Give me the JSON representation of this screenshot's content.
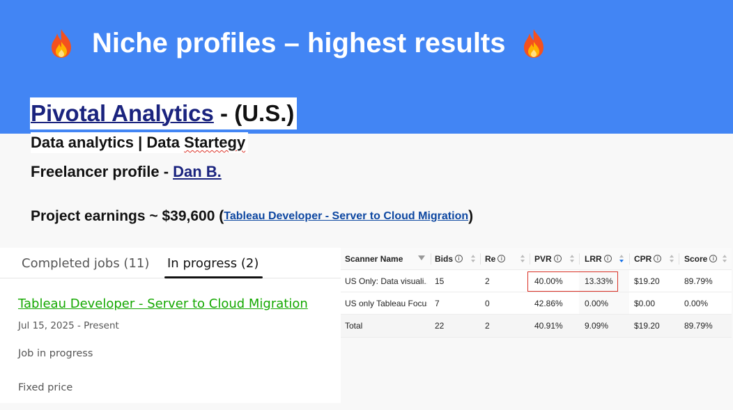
{
  "slide": {
    "title": "Niche profiles – highest results",
    "emoji_icon": "fire-icon",
    "banner_color": "#4285f4"
  },
  "profile": {
    "company_link": "Pivotal Analytics",
    "company_suffix": "- (U.S.)",
    "specialty_part1": "Data analytics | Data ",
    "specialty_part2": "Startegy",
    "freelancer_label": "Freelancer profile -",
    "freelancer_name": "Dan B.",
    "earnings_label": "Project earnings ~ $39,600 (",
    "earnings_link": "Tableau Developer - Server to Cloud Migration",
    "earnings_close": ")"
  },
  "jobs_panel": {
    "tabs": [
      {
        "label": "Completed jobs (11)",
        "active": false
      },
      {
        "label": "In progress (2)",
        "active": true
      }
    ],
    "job": {
      "title": "Tableau Developer - Server to Cloud Migration",
      "dates": "Jul 15, 2025 - Present",
      "status": "Job in progress",
      "type": "Fixed price"
    },
    "accent_color": "#14a800"
  },
  "scanner_table": {
    "columns": [
      "Scanner Name",
      "Bids",
      "Re",
      "PVR",
      "LRR",
      "CPR",
      "Score"
    ],
    "rows": [
      [
        "US Only: Data visuali...",
        "15",
        "2",
        "40.00%",
        "13.33%",
        "$19.20",
        "89.79%"
      ],
      [
        "US only Tableau Focus",
        "7",
        "0",
        "42.86%",
        "0.00%",
        "$0.00",
        "0.00%"
      ],
      [
        "Total",
        "22",
        "2",
        "40.91%",
        "9.09%",
        "$19.20",
        "89.79%"
      ]
    ],
    "highlight_color": "#d93025",
    "sorted_column": "LRR"
  }
}
